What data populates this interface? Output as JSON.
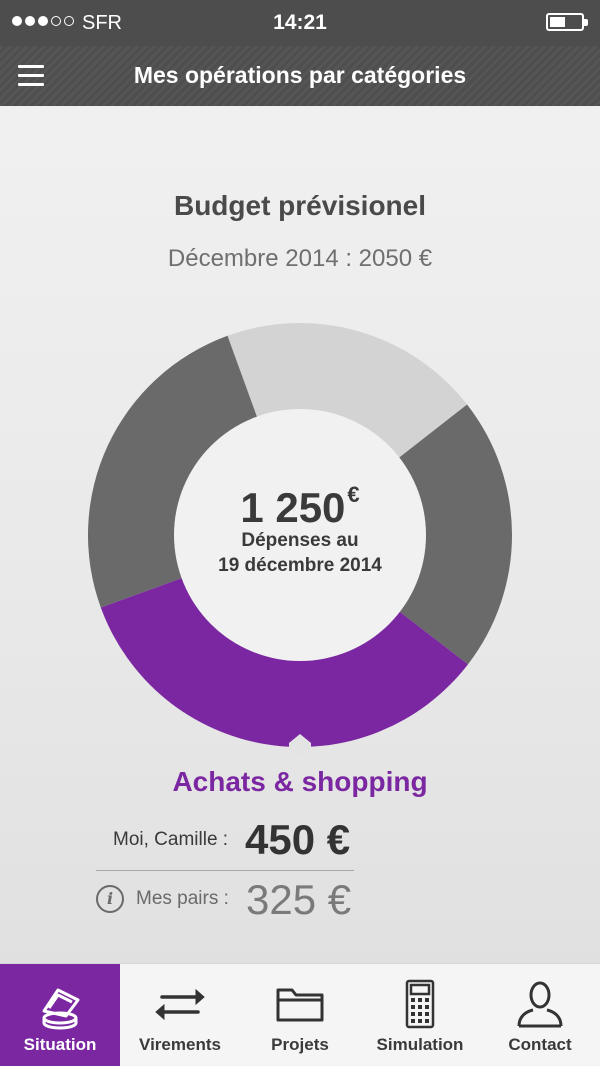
{
  "status_bar": {
    "signal_dots_filled": 3,
    "signal_dots_total": 5,
    "carrier": "SFR",
    "time": "14:21",
    "battery_level": 0.5
  },
  "header": {
    "title": "Mes opérations par catégories",
    "menu_icon": "hamburger-menu-icon"
  },
  "budget": {
    "title": "Budget prévisionel",
    "subtitle": "Décembre 2014 : 2050 €"
  },
  "donut": {
    "center_amount": "1 250",
    "center_currency": "€",
    "center_line1": "Dépenses au",
    "center_line2": "19 décembre 2014",
    "segments": [
      {
        "color": "#d3d3d3",
        "share": 0.2
      },
      {
        "color": "#6a6a6a",
        "share": 0.21
      },
      {
        "color": "#7b27a2",
        "share": 0.34
      },
      {
        "color": "#6a6a6a",
        "share": 0.25
      }
    ]
  },
  "category": {
    "title": "Achats & shopping",
    "me_label": "Moi, Camille :",
    "me_value": "450 €",
    "pairs_label": "Mes pairs :",
    "pairs_value": "325 €",
    "info_icon_glyph": "i"
  },
  "colors": {
    "accent": "#7b27a2",
    "header_bg": "#555555",
    "tab_bar_bg": "#f5f5f5"
  },
  "tabs": [
    {
      "label": "Situation",
      "icon": "coins-stack-icon",
      "active": true
    },
    {
      "label": "Virements",
      "icon": "transfer-arrows-icon",
      "active": false
    },
    {
      "label": "Projets",
      "icon": "folder-icon",
      "active": false
    },
    {
      "label": "Simulation",
      "icon": "calculator-icon",
      "active": false
    },
    {
      "label": "Contact",
      "icon": "person-icon",
      "active": false
    }
  ]
}
